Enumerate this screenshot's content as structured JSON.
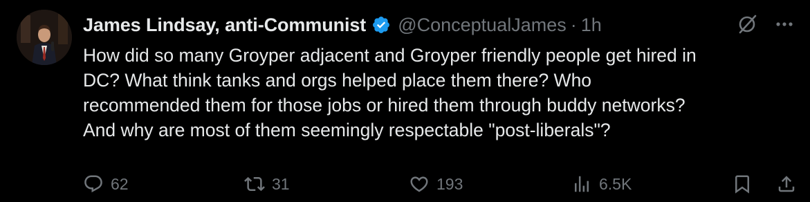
{
  "tweet": {
    "author": {
      "display_name": "James Lindsay, anti-Communist",
      "handle": "@ConceptualJames",
      "verified_color": "#1d9bf0"
    },
    "separator": "·",
    "timestamp": "1h",
    "text": "How did so many Groyper adjacent and Groyper friendly people get hired in\nDC? What think tanks and orgs helped place them there? Who\nrecommended them for those jobs or hired them through buddy networks?\nAnd why are most of them seemingly respectable \"post-liberals\"?",
    "top_icons": [
      "grok-icon",
      "more-icon"
    ],
    "metrics": {
      "replies": "62",
      "reposts": "31",
      "likes": "193",
      "views": "6.5K"
    },
    "colors": {
      "background": "#000000",
      "text": "#e7e9ea",
      "secondary": "#71767b"
    }
  }
}
